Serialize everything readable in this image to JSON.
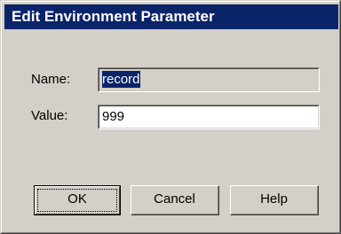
{
  "window": {
    "title": "Edit Environment Parameter"
  },
  "form": {
    "name_label": "Name:",
    "name_value": "record",
    "value_label": "Value:",
    "value_value": "999"
  },
  "buttons": {
    "ok_label": "OK",
    "cancel_label": "Cancel",
    "help_label": "Help"
  },
  "colors": {
    "title_bar": "#0a246a",
    "dialog_face": "#d4d0c8",
    "selection": "#0a246a"
  }
}
